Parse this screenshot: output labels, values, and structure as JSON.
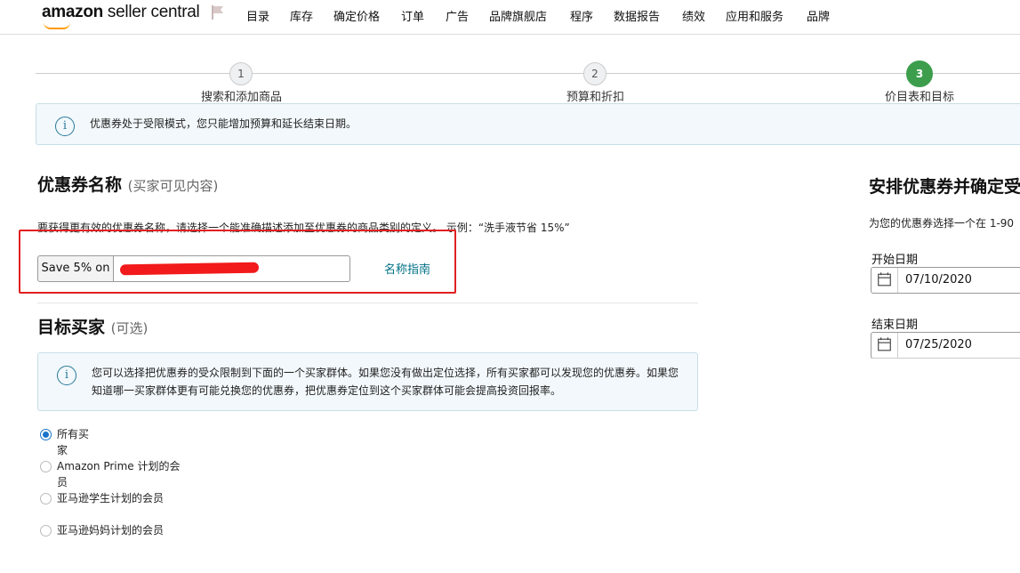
{
  "nav": {
    "logo_brand": "amazon",
    "logo_rest": " seller central",
    "items": [
      "目录",
      "库存",
      "确定价格",
      "订单",
      "广告",
      "品牌旗舰店",
      "程序",
      "数据报告",
      "绩效",
      "应用和服务",
      "品牌"
    ]
  },
  "steps": [
    {
      "number": "1",
      "label": "搜索和添加商品"
    },
    {
      "number": "2",
      "label": "预算和折扣"
    },
    {
      "number": "3",
      "label": "价目表和目标"
    }
  ],
  "notice": {
    "text": "优惠券处于受限模式，您只能增加预算和延长结束日期。"
  },
  "coupon_name": {
    "title": "优惠券名称",
    "subtitle": "(买家可见内容)",
    "description": "要获得更有效的优惠券名称，请选择一个能准确描述添加至优惠券的商品类别的定义。 示例：“洗手液节省 15%”",
    "prefix": "Save 5% on",
    "guide_link": "名称指南"
  },
  "target_buyers": {
    "title": "目标买家",
    "subtitle": "(可选)",
    "info": "您可以选择把优惠券的受众限制到下面的一个买家群体。如果您没有做出定位选择，所有买家都可以发现您的优惠券。如果您知道哪一买家群体更有可能兑换您的优惠券，把优惠券定位到这个买家群体可能会提高投资回报率。",
    "options": [
      {
        "label": "所有买家",
        "checked": true
      },
      {
        "label": "Amazon Prime 计划的会员",
        "checked": false
      },
      {
        "label": "亚马逊学生计划的会员",
        "checked": false
      },
      {
        "label": "亚马逊妈妈计划的会员",
        "checked": false
      }
    ]
  },
  "schedule": {
    "title": "安排优惠券并确定受",
    "description": "为您的优惠券选择一个在 1-90",
    "start_label": "开始日期",
    "start_value": "07/10/2020",
    "end_label": "结束日期",
    "end_value": "07/25/2020"
  },
  "colors": {
    "accent": "#007185",
    "step_active": "#3c9e4d",
    "highlight": "#e12020"
  }
}
